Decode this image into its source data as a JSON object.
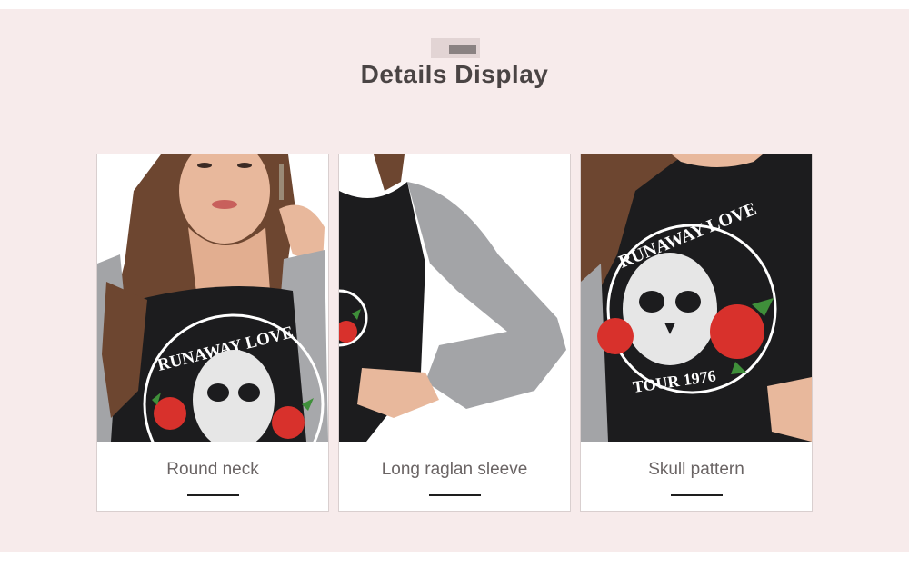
{
  "section": {
    "title": "Details Display"
  },
  "cards": [
    {
      "caption": "Round neck"
    },
    {
      "caption": "Long raglan sleeve"
    },
    {
      "caption": "Skull pattern"
    }
  ],
  "print": {
    "arc_text": "RUNAWAY LOVE",
    "bottom_text": "TOUR 1976"
  },
  "colors": {
    "background": "#f7ebeb",
    "title": "#4a4444",
    "caption": "#6a6464",
    "shirt_body": "#1c1c1e",
    "sleeve": "#a3a4a7",
    "rose": "#d8312c"
  }
}
